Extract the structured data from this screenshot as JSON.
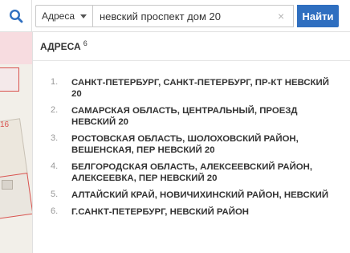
{
  "search": {
    "type_label": "Адреса",
    "query": "невский проспект дом 20",
    "clear_glyph": "×",
    "button_label": "Найти"
  },
  "icons": {
    "search": "search-icon",
    "clear": "close-icon",
    "caret": "chevron-down-icon"
  },
  "map": {
    "label_16": "16"
  },
  "colors": {
    "accent": "#2f6fc0",
    "map_red": "#d9534f"
  },
  "panel": {
    "title": "АДРЕСА",
    "count": "6",
    "results": [
      {
        "num": "1.",
        "text": "САНКТ-ПЕТЕРБУРГ, САНКТ-ПЕТЕРБУРГ, ПР-КТ НЕВСКИЙ 20"
      },
      {
        "num": "2.",
        "text": "САМАРСКАЯ ОБЛАСТЬ, ЦЕНТРАЛЬНЫЙ, ПРОЕЗД НЕВСКИЙ 20"
      },
      {
        "num": "3.",
        "text": "РОСТОВСКАЯ ОБЛАСТЬ, ШОЛОХОВСКИЙ РАЙОН, ВЕШЕНСКАЯ, ПЕР НЕВСКИЙ 20"
      },
      {
        "num": "4.",
        "text": "БЕЛГОРОДСКАЯ ОБЛАСТЬ, АЛЕКСЕЕВСКИЙ РАЙОН, АЛЕКСЕЕВКА, ПЕР НЕВСКИЙ 20"
      },
      {
        "num": "5.",
        "text": "АЛТАЙСКИЙ КРАЙ, НОВИЧИХИНСКИЙ РАЙОН, НЕВСКИЙ"
      },
      {
        "num": "6.",
        "text": "Г.САНКТ-ПЕТЕРБУРГ, НЕВСКИЙ РАЙОН"
      }
    ]
  }
}
